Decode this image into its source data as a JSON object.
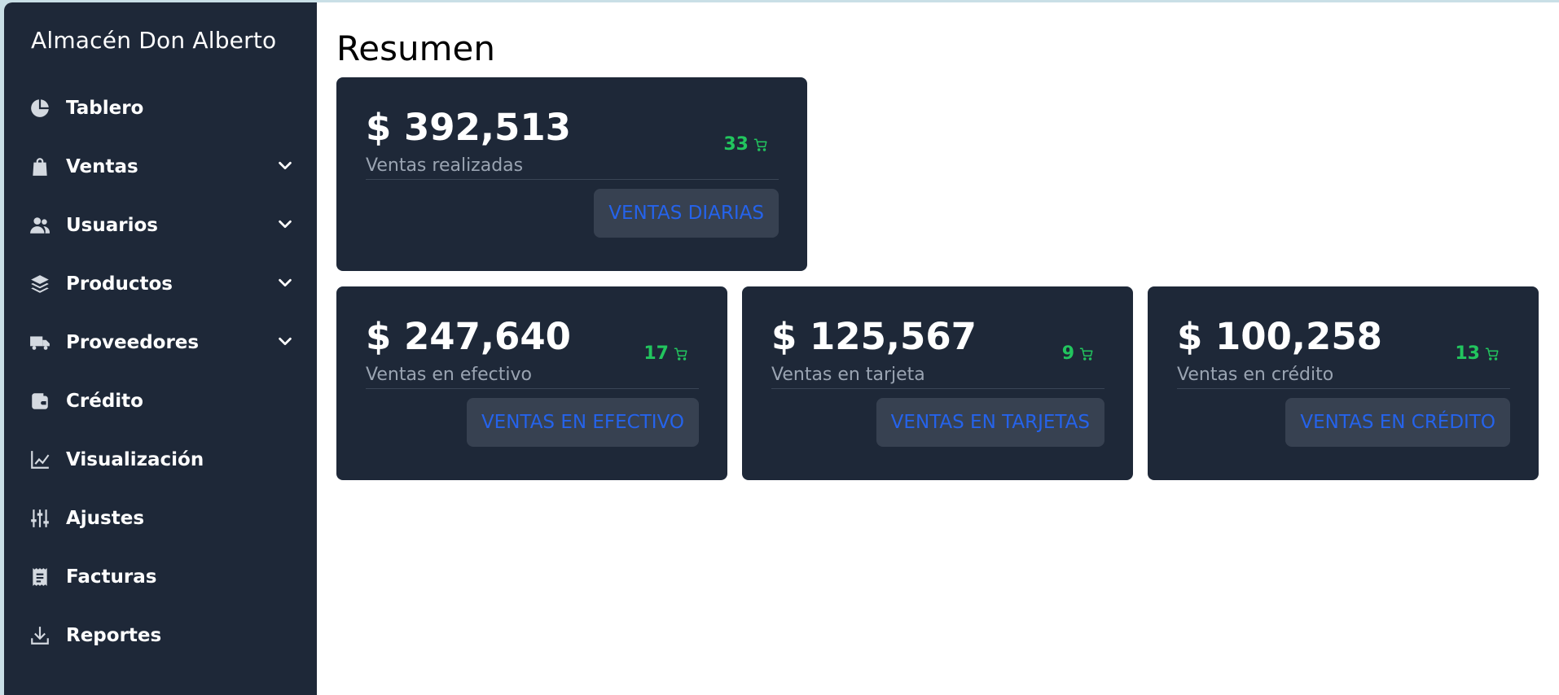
{
  "sidebar": {
    "brand": "Almacén Don Alberto",
    "items": [
      {
        "label": "Tablero",
        "icon": "pie-chart-icon",
        "expandable": false
      },
      {
        "label": "Ventas",
        "icon": "shopping-bag-icon",
        "expandable": true
      },
      {
        "label": "Usuarios",
        "icon": "users-icon",
        "expandable": true
      },
      {
        "label": "Productos",
        "icon": "layers-icon",
        "expandable": true
      },
      {
        "label": "Proveedores",
        "icon": "truck-icon",
        "expandable": true
      },
      {
        "label": "Crédito",
        "icon": "wallet-icon",
        "expandable": false
      },
      {
        "label": "Visualización",
        "icon": "line-chart-icon",
        "expandable": false
      },
      {
        "label": "Ajustes",
        "icon": "sliders-icon",
        "expandable": false
      },
      {
        "label": "Facturas",
        "icon": "receipt-icon",
        "expandable": false
      },
      {
        "label": "Reportes",
        "icon": "download-icon",
        "expandable": false
      }
    ]
  },
  "main": {
    "title": "Resumen",
    "cards": [
      {
        "amount": "$ 392,513",
        "subtitle": "Ventas realizadas",
        "count": "33",
        "button": "VENTAS DIARIAS"
      },
      {
        "amount": "$ 247,640",
        "subtitle": "Ventas en efectivo",
        "count": "17",
        "button": "VENTAS EN EFECTIVO"
      },
      {
        "amount": "$ 125,567",
        "subtitle": "Ventas en tarjeta",
        "count": "9",
        "button": "VENTAS EN TARJETAS"
      },
      {
        "amount": "$ 100,258",
        "subtitle": "Ventas en crédito",
        "count": "13",
        "button": "VENTAS EN CRÉDITO"
      }
    ]
  },
  "colors": {
    "sidebar_bg": "#1e2838",
    "card_bg": "#1e2838",
    "count_green": "#22c55e",
    "button_text_blue": "#2563eb",
    "button_bg": "#374151",
    "subtitle_gray": "#9aa4b2"
  }
}
